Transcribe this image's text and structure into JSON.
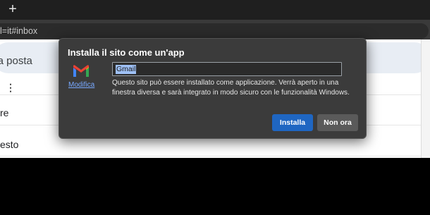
{
  "browser": {
    "new_tab_glyph": "+",
    "address_text": "l=it#inbox"
  },
  "gmail_page": {
    "search_placeholder": "lla posta",
    "more_glyph": "⋮",
    "rows": [
      {
        "text": "re"
      },
      {
        "text": "esto"
      }
    ]
  },
  "install_dialog": {
    "title": "Installa il sito come un'app",
    "app_icon": "gmail-logo-icon",
    "modify_link": "Modifica",
    "app_name_value": "Gmail",
    "description": "Questo sito può essere installato come applicazione. Verrà aperto in una finestra diversa e sarà integrato in modo sicuro con le funzionalità Windows.",
    "install_button": "Installa",
    "cancel_button": "Non ora",
    "colors": {
      "install_accent": "#1f66c2",
      "background": "#3b3b3b"
    }
  }
}
